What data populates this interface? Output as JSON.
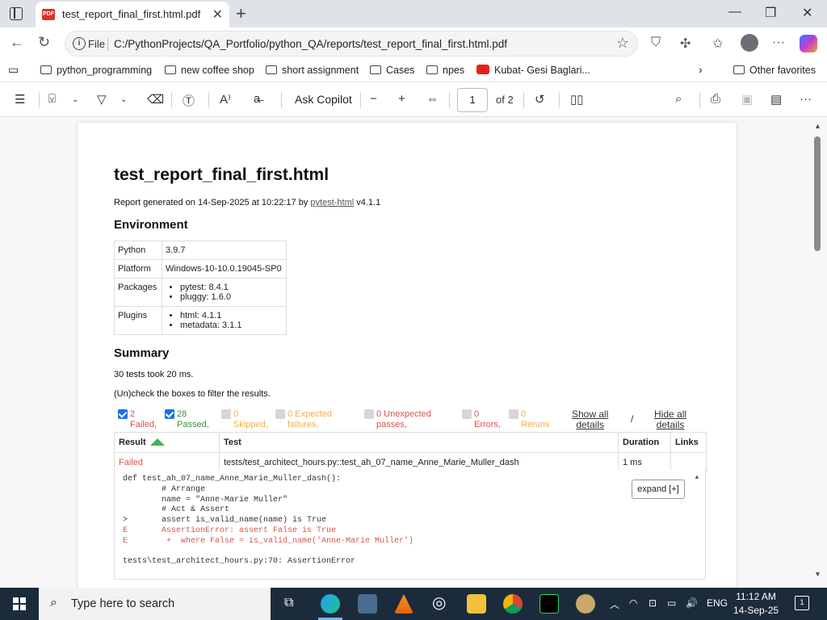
{
  "browser": {
    "tab_title": "test_report_final_first.html.pdf",
    "address_scheme_label": "File",
    "url": "C:/PythonProjects/QA_Portfolio/python_QA/reports/test_report_final_first.html.pdf"
  },
  "favorites": {
    "items": [
      "python_programming",
      "new coffee shop",
      "short assignment",
      "Cases",
      "npes",
      "Kubat- Gesi Baglari..."
    ],
    "other": "Other favorites"
  },
  "pdf_toolbar": {
    "ask_copilot": "Ask Copilot",
    "page_current": "1",
    "page_total_label": "of 2",
    "icons": [
      "contents-icon",
      "highlight-icon",
      "draw-icon",
      "erase-icon",
      "text-icon",
      "read-aloud-icon",
      "translate-icon",
      "zoom-out-icon",
      "zoom-in-icon",
      "fit-icon",
      "rotate-icon",
      "page-view-icon",
      "search-icon",
      "print-icon",
      "save-icon",
      "save-as-icon",
      "more-icon"
    ]
  },
  "report": {
    "title": "test_report_final_first.html",
    "generated_prefix": "Report generated on 14-Sep-2025 at 10:22:17 by ",
    "generated_link": "pytest-html",
    "generated_suffix": " v4.1.1",
    "environment_heading": "Environment",
    "environment": {
      "python_key": "Python",
      "python_val": "3.9.7",
      "platform_key": "Platform",
      "platform_val": "Windows-10-10.0.19045-SP0",
      "packages_key": "Packages",
      "packages": [
        "pytest: 8.4.1",
        "pluggy: 1.6.0"
      ],
      "plugins_key": "Plugins",
      "plugins": [
        "html: 4.1.1",
        "metadata: 3.1.1"
      ]
    },
    "summary_heading": "Summary",
    "summary_text": "30 tests took 20 ms.",
    "filter_hint": "(Un)check the boxes to filter the results.",
    "filters": [
      {
        "line1": "2",
        "line2": "Failed,",
        "color": "#d9534f",
        "checked": true
      },
      {
        "line1": "28",
        "line2": "Passed,",
        "color": "#3c8d3c",
        "checked": true
      },
      {
        "line1": "0",
        "line2": "Skipped,",
        "color": "#f0ad4e",
        "checked": false
      },
      {
        "line1": "0 Expected",
        "line2": "failures,",
        "color": "#f0ad4e",
        "checked": false
      },
      {
        "line1": "0 Unexpected",
        "line2": "passes,",
        "color": "#d9534f",
        "checked": false
      },
      {
        "line1": "0",
        "line2": "Errors,",
        "color": "#d9534f",
        "checked": false
      },
      {
        "line1": "0",
        "line2": "Reruns",
        "color": "#f0ad4e",
        "checked": false
      }
    ],
    "show_all": [
      "Show all",
      "details"
    ],
    "slash": "/",
    "hide_all": [
      "Hide all",
      "details"
    ],
    "table": {
      "headers": [
        "Result",
        "Test",
        "Duration",
        "Links"
      ],
      "row": {
        "result": "Failed",
        "test": "tests/test_architect_hours.py::test_ah_07_name_Anne_Marie_Muller_dash",
        "duration": "1 ms",
        "links": ""
      }
    },
    "log": {
      "lines": [
        {
          "text": "def test_ah_07_name_Anne_Marie_Muller_dash():",
          "error": false
        },
        {
          "text": "        # Arrange",
          "error": false
        },
        {
          "text": "        name = \"Anne-Marie Muller\"",
          "error": false
        },
        {
          "text": "        # Act & Assert",
          "error": false
        },
        {
          "text": ">       assert is_valid_name(name) is True",
          "error": false
        },
        {
          "text": "E       AssertionError: assert False is True",
          "error": true
        },
        {
          "text": "E        +  where False = is_valid_name('Anne-Marie Muller')",
          "error": true
        },
        {
          "text": "",
          "error": false
        },
        {
          "text": "tests\\test_architect_hours.py:70: AssertionError",
          "error": false
        }
      ],
      "expand_label": "expand [+]"
    }
  },
  "taskbar": {
    "search_placeholder": "Type here to search",
    "lang": "ENG",
    "time": "11:12 AM",
    "date": "14-Sep-25",
    "notification_count": "1"
  }
}
